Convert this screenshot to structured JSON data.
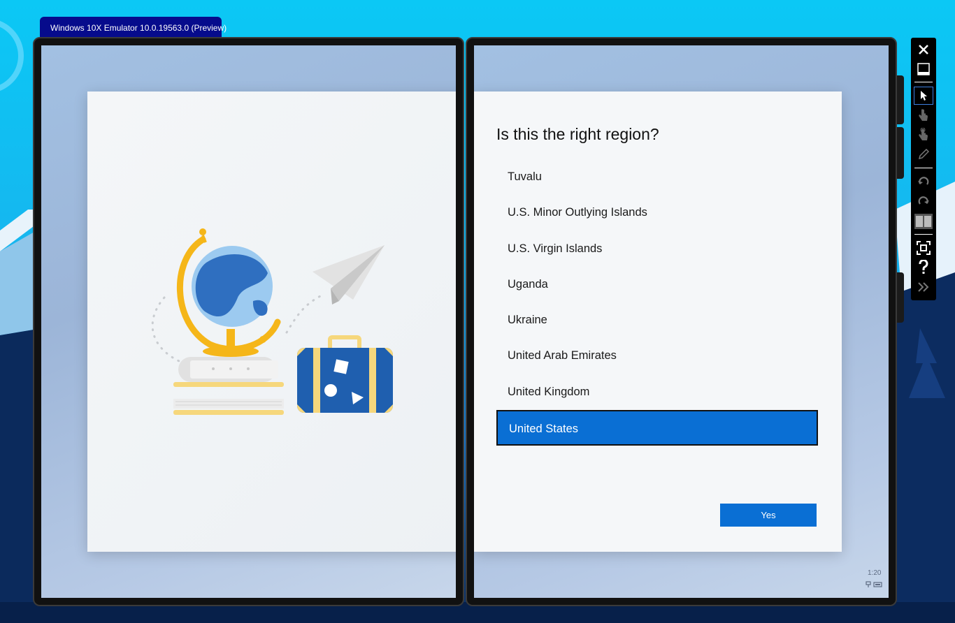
{
  "window": {
    "title": "Windows 10X Emulator 10.0.19563.0 (Preview)"
  },
  "oobe": {
    "question": "Is this the right region?",
    "regions": [
      "Tuvalu",
      "U.S. Minor Outlying Islands",
      "U.S. Virgin Islands",
      "Uganda",
      "Ukraine",
      "United Arab Emirates",
      "United Kingdom",
      "United States"
    ],
    "selected_region": "United States",
    "yes_button": "Yes",
    "clock": "1:20"
  },
  "toolbar": {
    "icons": [
      "close-icon",
      "minimize-icon",
      "mouse-pointer-icon",
      "single-touch-icon",
      "multi-touch-icon",
      "pen-icon",
      "rotate-left-icon",
      "rotate-right-icon",
      "dual-screen-icon",
      "fit-screen-icon",
      "help-icon",
      "expand-chevron-icon"
    ]
  },
  "colors": {
    "accent": "#0a6fd4",
    "title_tab": "#060b8c",
    "desktop_sky": "#0bc8f5",
    "globe_blue": "#2f6fc0",
    "globe_stand": "#f5b619",
    "suitcase_blue": "#1f5faf"
  }
}
